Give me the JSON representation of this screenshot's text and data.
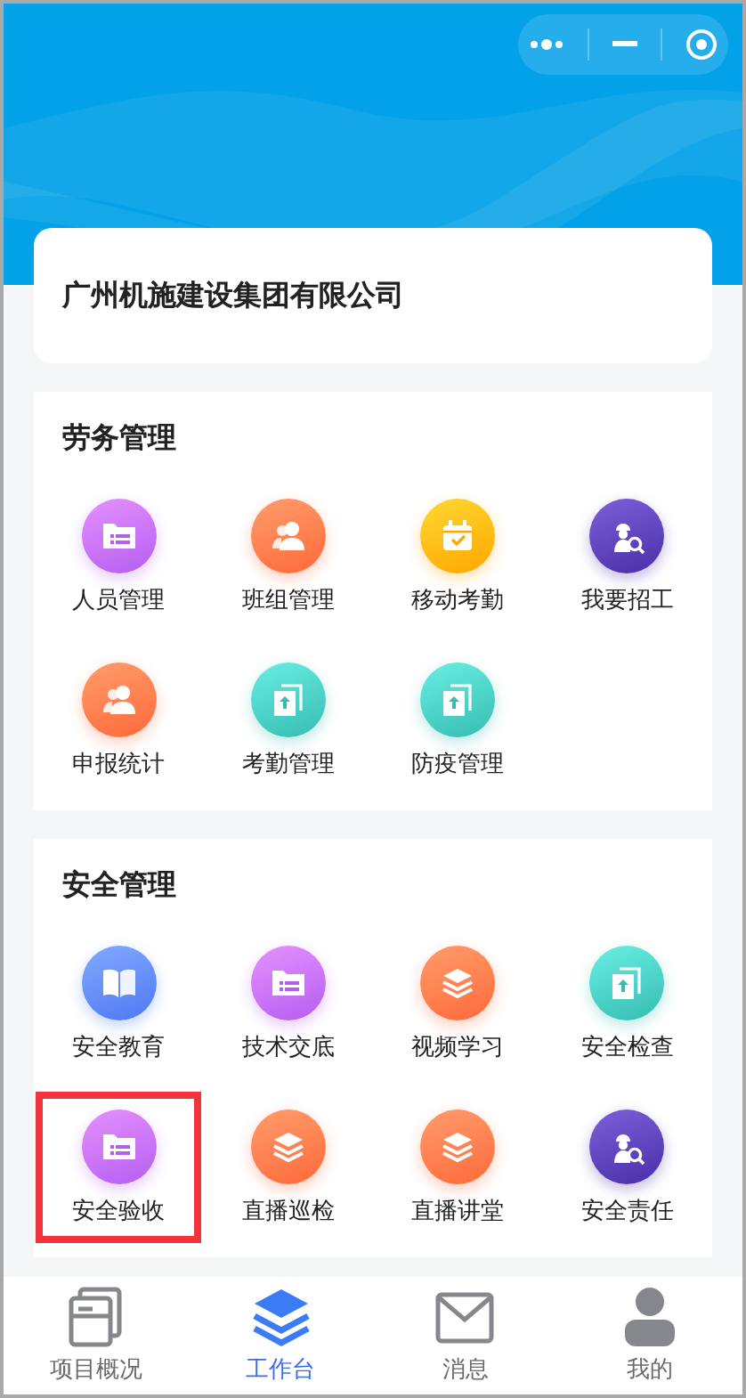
{
  "company": {
    "name": "广州机施建设集团有限公司"
  },
  "sections": [
    {
      "title": "劳务管理",
      "items": [
        {
          "label": "人员管理",
          "kind": "folder",
          "color": "#b45ef0",
          "highlighted": false
        },
        {
          "label": "班组管理",
          "kind": "people",
          "color": "#ff6a3a",
          "highlighted": false
        },
        {
          "label": "移动考勤",
          "kind": "calendar",
          "color": "#ffa600",
          "highlighted": false
        },
        {
          "label": "我要招工",
          "kind": "worker",
          "color": "#4a2ea8",
          "highlighted": false
        },
        {
          "label": "申报统计",
          "kind": "people",
          "color": "#ff6a3a",
          "highlighted": false
        },
        {
          "label": "考勤管理",
          "kind": "upload",
          "color": "#36bcb0",
          "highlighted": false
        },
        {
          "label": "防疫管理",
          "kind": "upload",
          "color": "#36bcb0",
          "highlighted": false
        }
      ]
    },
    {
      "title": "安全管理",
      "items": [
        {
          "label": "安全教育",
          "kind": "book",
          "color": "#4f78f2",
          "highlighted": false
        },
        {
          "label": "技术交底",
          "kind": "folder",
          "color": "#b45ef0",
          "highlighted": false
        },
        {
          "label": "视频学习",
          "kind": "layers",
          "color": "#ff6a3a",
          "highlighted": false
        },
        {
          "label": "安全检查",
          "kind": "upload",
          "color": "#36bcb0",
          "highlighted": false
        },
        {
          "label": "安全验收",
          "kind": "folder",
          "color": "#b45ef0",
          "highlighted": true
        },
        {
          "label": "直播巡检",
          "kind": "layers",
          "color": "#ff6a3a",
          "highlighted": false
        },
        {
          "label": "直播讲堂",
          "kind": "layers",
          "color": "#ff6a3a",
          "highlighted": false
        },
        {
          "label": "安全责任",
          "kind": "worker",
          "color": "#4a2ea8",
          "highlighted": false
        }
      ]
    }
  ],
  "tab_bar": [
    {
      "label": "项目概况",
      "kind": "documents",
      "selected": false
    },
    {
      "label": "工作台",
      "kind": "layers",
      "selected": true
    },
    {
      "label": "消息",
      "kind": "mail",
      "selected": false
    },
    {
      "label": "我的",
      "kind": "person",
      "selected": false
    }
  ]
}
